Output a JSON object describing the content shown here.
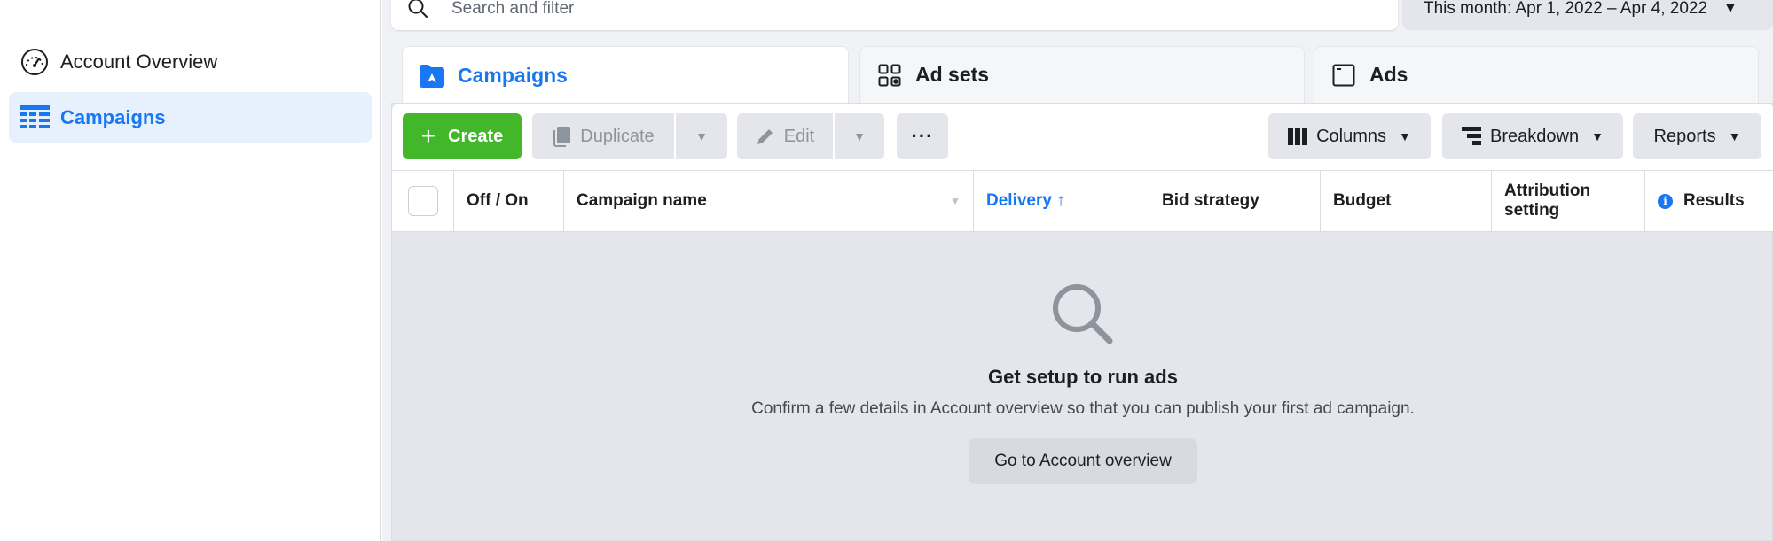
{
  "sidebar": {
    "items": [
      {
        "label": "Account Overview",
        "icon": "speedometer-icon",
        "active": false
      },
      {
        "label": "Campaigns",
        "icon": "table-grid-icon",
        "active": true
      }
    ]
  },
  "filters": {
    "search_placeholder": "Search and filter",
    "date_range": "This month: Apr 1, 2022 – Apr 4, 2022"
  },
  "tabs": [
    {
      "label": "Campaigns",
      "icon": "folder-icon",
      "active": true
    },
    {
      "label": "Ad sets",
      "icon": "grid-icon",
      "active": false
    },
    {
      "label": "Ads",
      "icon": "ad-window-icon",
      "active": false
    }
  ],
  "toolbar": {
    "create": "Create",
    "duplicate": "Duplicate",
    "edit": "Edit",
    "more": "···",
    "columns": "Columns",
    "breakdown": "Breakdown",
    "reports": "Reports"
  },
  "table": {
    "columns": [
      "Off / On",
      "Campaign name",
      "Delivery ↑",
      "Bid strategy",
      "Budget",
      "Attribution setting",
      "Results"
    ],
    "rows": []
  },
  "empty_state": {
    "title": "Get setup to run ads",
    "message": "Confirm a few details in Account overview so that you can publish your first ad campaign.",
    "button": "Go to Account overview"
  },
  "colors": {
    "accent": "#1877f2",
    "create_green": "#42b72a",
    "active_bg": "#e7f0fd"
  }
}
